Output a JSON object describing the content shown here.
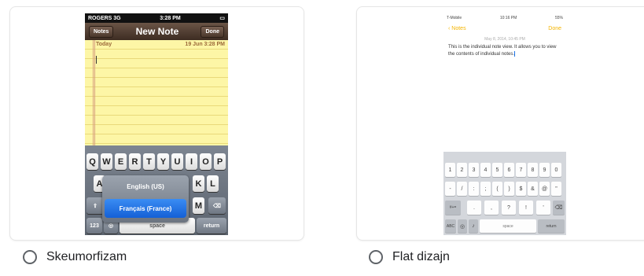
{
  "options": [
    {
      "label": "Skeumorfizam",
      "selected": false
    },
    {
      "label": "Flat dizajn",
      "selected": false
    }
  ],
  "skeuo_phone": {
    "carrier": "ROGERS 3G",
    "time": "3:28 PM",
    "nav_left": "Notes",
    "nav_title": "New Note",
    "nav_right": "Done",
    "note_day": "Today",
    "note_datetime": "19 Jun  3:28 PM",
    "keys_row1": [
      "Q",
      "W",
      "E",
      "R",
      "T",
      "Y",
      "U",
      "I",
      "O",
      "P"
    ],
    "keys_row2_visible": [
      "A",
      "K",
      "L"
    ],
    "keys_row3_visible": [
      "M"
    ],
    "lang_option_1": "English (US)",
    "lang_option_2": "Français (France)",
    "key_123": "123",
    "key_space": "space",
    "key_return": "return",
    "paper_color": "#fdf6a6",
    "nav_color": "#4a372b"
  },
  "flat_phone": {
    "carrier": "T-Mobile",
    "time": "10:16 PM",
    "battery": "55%",
    "nav_left": "Notes",
    "nav_right": "Done",
    "note_date": "May 8, 2014, 10:45 PM",
    "note_text": "This is the individual note view. It allows you to view the contents of individual notes.",
    "keys_row1": [
      "1",
      "2",
      "3",
      "4",
      "5",
      "6",
      "7",
      "8",
      "9",
      "0"
    ],
    "keys_row2": [
      "-",
      "/",
      ":",
      ";",
      "(",
      ")",
      "$",
      "&",
      "@",
      "\""
    ],
    "keys_row3": [
      ".",
      ",",
      "?",
      "!",
      "'"
    ],
    "key_shift": "#+=",
    "key_abc": "ABC",
    "key_space": "space",
    "key_return": "return",
    "accent": "#f4b400"
  }
}
